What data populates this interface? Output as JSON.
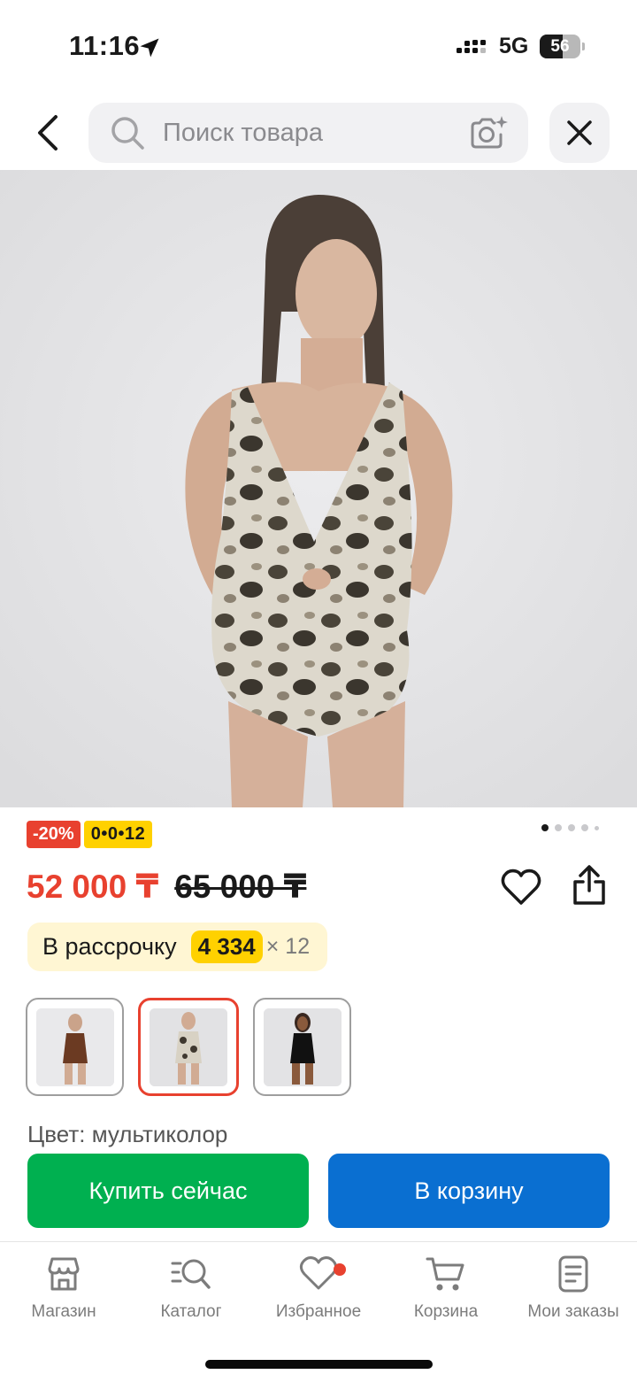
{
  "status_bar": {
    "time": "11:16",
    "network": "5G",
    "battery": "56",
    "battery_level": 0.56
  },
  "search": {
    "placeholder": "Поиск товара",
    "value": ""
  },
  "icons": {
    "back": "chevron-left-icon",
    "search": "search-icon",
    "camera": "camera-search-icon",
    "close": "close-icon",
    "favorite": "heart-icon",
    "share": "share-icon"
  },
  "product": {
    "photo_index": 1,
    "photo_count": 5,
    "discount_badge": "-20%",
    "installment_badge": "0•0•12",
    "price_current": "52 000 ₸",
    "price_old": "65 000 ₸",
    "installment": {
      "label": "В рассрочку",
      "amount": "4 334",
      "multiplier": "× 12"
    },
    "variants": [
      {
        "name": "brown",
        "selected": false
      },
      {
        "name": "leopard",
        "selected": true
      },
      {
        "name": "black",
        "selected": false
      }
    ],
    "color_text": "Цвет: мультиколор"
  },
  "actions": {
    "buy_now": "Купить сейчас",
    "add_to_cart": "В корзину"
  },
  "tabbar": {
    "items": [
      {
        "label": "Магазин",
        "icon": "store-icon"
      },
      {
        "label": "Каталог",
        "icon": "catalog-search-icon"
      },
      {
        "label": "Избранное",
        "icon": "heart-icon",
        "has_badge": true
      },
      {
        "label": "Корзина",
        "icon": "cart-icon"
      },
      {
        "label": "Мои заказы",
        "icon": "orders-icon"
      }
    ]
  },
  "colors": {
    "accent_red": "#e8412f",
    "yellow": "#ffd100",
    "buy_green": "#00b050",
    "cart_blue": "#0a6fd1"
  }
}
